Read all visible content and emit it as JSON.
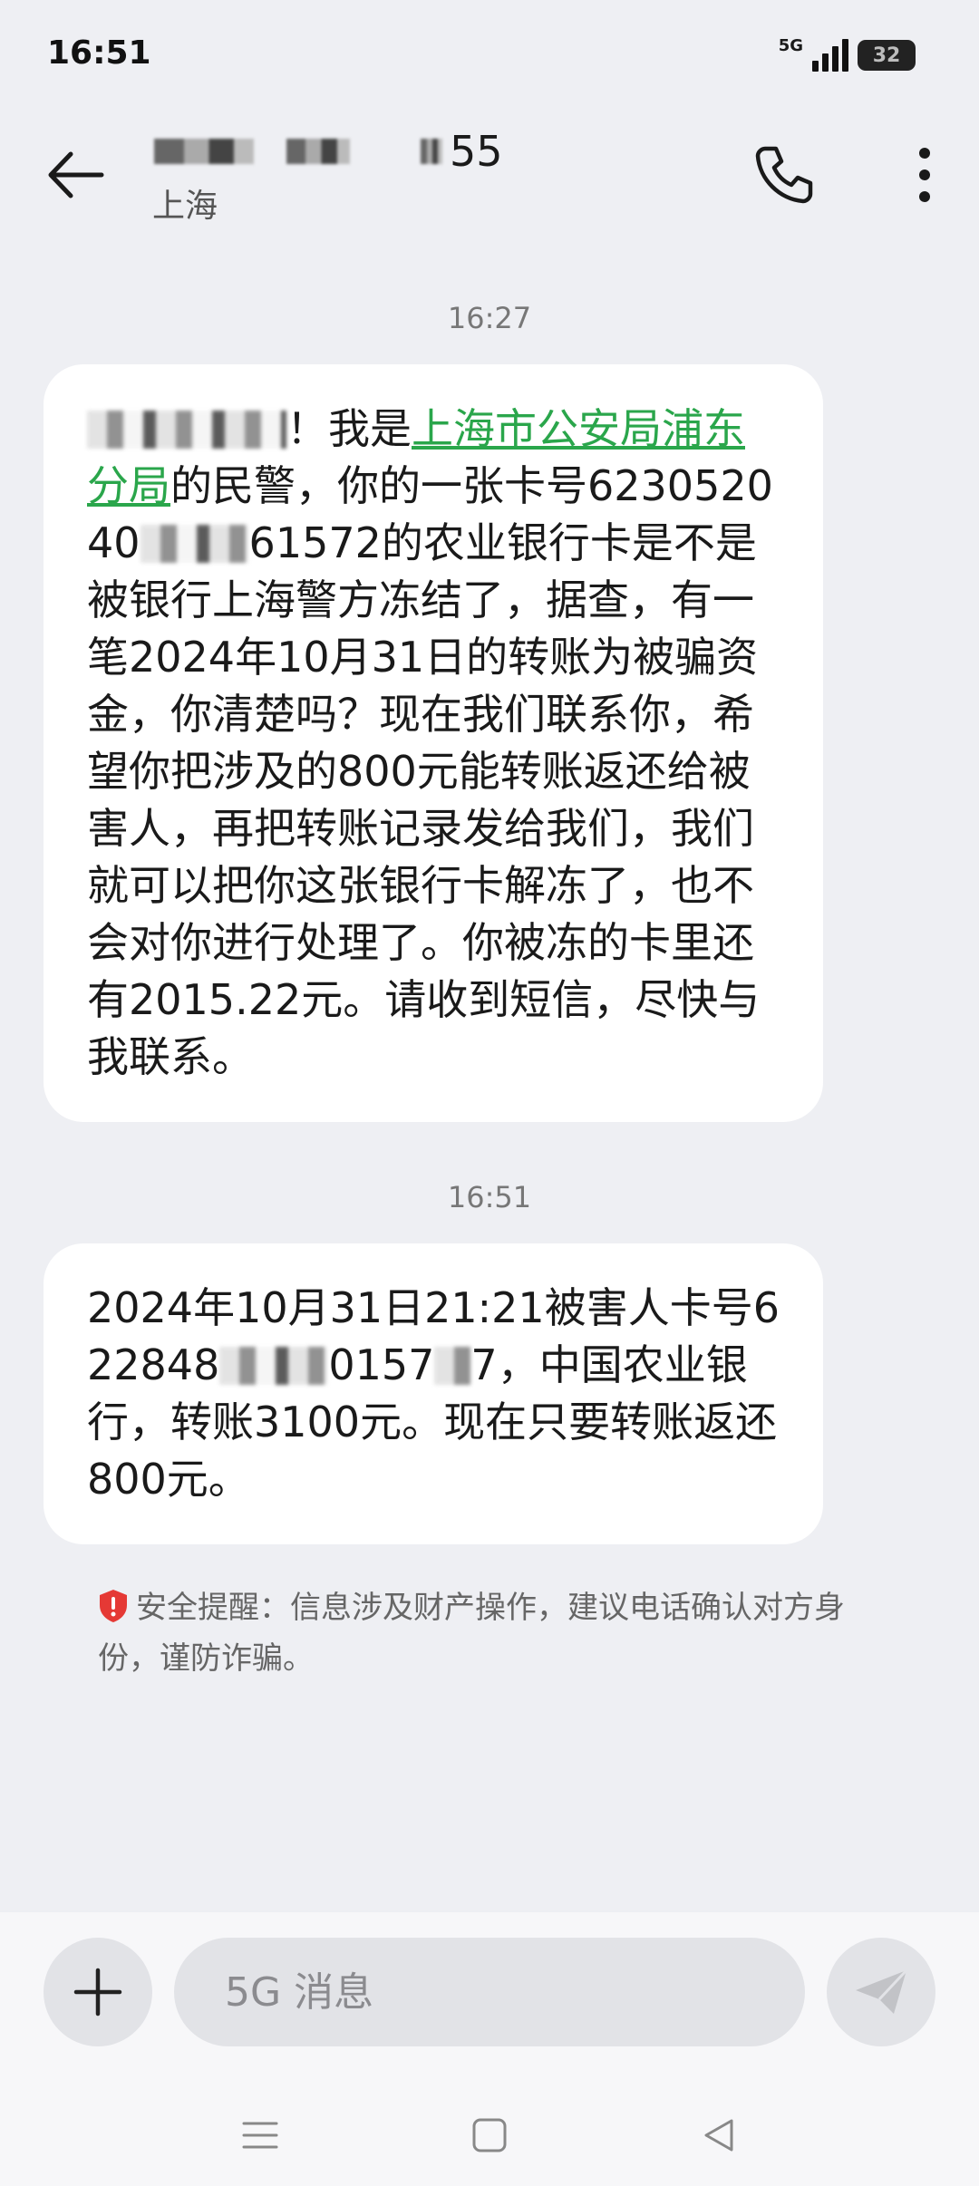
{
  "status": {
    "time": "16:51",
    "network": "5G",
    "battery": "32"
  },
  "header": {
    "contact_suffix": "55",
    "contact_location": "上海"
  },
  "messages": [
    {
      "time": "16:27",
      "segments": {
        "s1": "！我是",
        "link": "上海市公安局浦东分局",
        "s2": "的民警，你的一张卡号623052040",
        "s3": "61572的农业银行卡是不是被银行上海警方冻结了，据查，有一笔2024年10月31日的转账为被骗资金，你清楚吗？现在我们联系你，希望你把涉及的800元能转账返还给被害人，再把转账记录发给我们，我们就可以把你这张银行卡解冻了，也不会对你进行处理了。你被冻的卡里还有2015.22元。请收到短信，尽快与我联系。"
      }
    },
    {
      "time": "16:51",
      "segments": {
        "s1": "2024年10月31日21:21被害人卡号622848",
        "s2": "0157",
        "s3": "7，中国农业银行，转账3100元。现在只要转账返还800元。"
      }
    }
  ],
  "security_note": {
    "text": "安全提醒：信息涉及财产操作，建议电话确认对方身份，谨防诈骗。"
  },
  "composer": {
    "placeholder": "5G 消息"
  },
  "icons": {
    "back": "back-arrow-icon",
    "call": "phone-icon",
    "more": "more-vertical-icon",
    "shield": "shield-alert-icon",
    "plus": "plus-icon",
    "send": "send-icon",
    "nav_menu": "menu-icon",
    "nav_home": "home-square-icon",
    "nav_back": "back-triangle-icon"
  },
  "colors": {
    "link": "#2aa64b",
    "shield": "#e53935",
    "background": "#eeeff3",
    "bubble": "#ffffff"
  }
}
